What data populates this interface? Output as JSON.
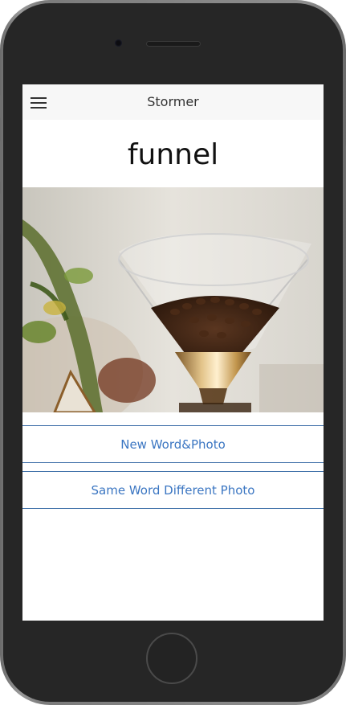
{
  "app": {
    "title": "Stormer"
  },
  "word": {
    "text": "funnel"
  },
  "photo": {
    "description_icon": "coffee-beans-in-glass-funnel-photo"
  },
  "actions": {
    "new_label": "New Word&Photo",
    "same_label": "Same Word Different Photo"
  },
  "colors": {
    "accent": "#3b76c2",
    "rule": "#3e6fa8",
    "navbar_bg": "#f7f7f7",
    "device_body": "#262626"
  },
  "icons": {
    "menu": "hamburger-menu-icon"
  }
}
